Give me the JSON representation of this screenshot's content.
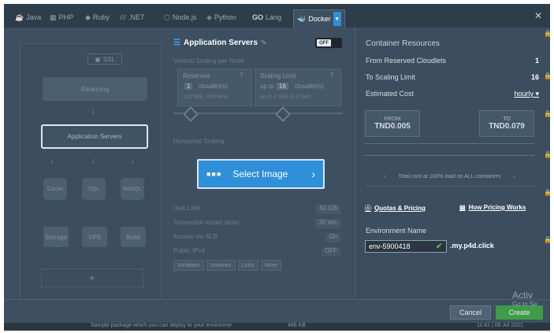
{
  "tabs": [
    {
      "label": "Java",
      "icon": "java-icon"
    },
    {
      "label": "PHP",
      "icon": "php-icon"
    },
    {
      "label": "Ruby",
      "icon": "ruby-icon"
    },
    {
      "label": ".NET",
      "icon": "dotnet-icon"
    },
    {
      "label": "Node.js",
      "icon": "nodejs-icon"
    },
    {
      "label": "Python",
      "icon": "python-icon"
    },
    {
      "label": "Lang",
      "icon": "go-icon",
      "prefix": "GO"
    },
    {
      "label": "Docker",
      "icon": "docker-icon",
      "active": true
    }
  ],
  "topology": {
    "ssl": "SSL",
    "balancing": "Balancing",
    "app_servers": "Application Servers",
    "cache": "Cache",
    "sql": "SQL",
    "nosql": "NoSQL",
    "storage": "Storage",
    "vps": "VPS",
    "build": "Build",
    "add": "+"
  },
  "config": {
    "title": "Application Servers",
    "toggle": "OFF",
    "vertical_scaling": "Vertical Scaling per Node",
    "reserved_label": "Reserved",
    "reserved_value": "1",
    "reserved_unit": "cloudlet(s)",
    "reserved_sub": "128 MiB, 400 MHz",
    "limit_label": "Scaling Limit",
    "limit_prefix": "up to",
    "limit_value": "16",
    "limit_unit": "cloudlet(s)",
    "limit_sub": "up to 2 GiB, 6.4 GHz",
    "horizontal_scaling": "Horizontal Scaling",
    "select_image": "Select Image",
    "disk_limit_label": "Disk Limit",
    "disk_limit_value": "50 GB",
    "restart_label": "Sequential restart delay",
    "restart_value": "30 sec",
    "ssl_label": "Access via SLB",
    "ssl_value": "On",
    "ipv4_label": "Public IPv4",
    "ipv4_value": "OFF",
    "buttons": [
      "Variables",
      "Volumes",
      "Links",
      "More"
    ]
  },
  "resources": {
    "title": "Container Resources",
    "reserved_label": "From Reserved Cloudlets",
    "reserved_value": "1",
    "scaling_label": "To Scaling Limit",
    "scaling_value": "16",
    "cost_label": "Estimated Cost",
    "cost_period": "hourly",
    "from_label": "FROM",
    "from_value": "TND0.005",
    "to_label": "TO",
    "to_value": "TND0.079",
    "total_cost": "Total cost at 100% load on ALL containers",
    "quotas": "Quotas & Pricing",
    "how_pricing": "How Pricing Works",
    "env_label": "Environment Name",
    "env_value": "env-5900418",
    "env_suffix": ".my.p4d.click"
  },
  "footer": {
    "cancel": "Cancel",
    "create": "Create"
  },
  "watermark": {
    "line1": "Activ",
    "line2": "Go to Se"
  },
  "bottom_strip": {
    "text": "Sample package which you can deploy to your environme",
    "size": "488 KB",
    "date": "11:41 | 08 Jul 2021"
  }
}
